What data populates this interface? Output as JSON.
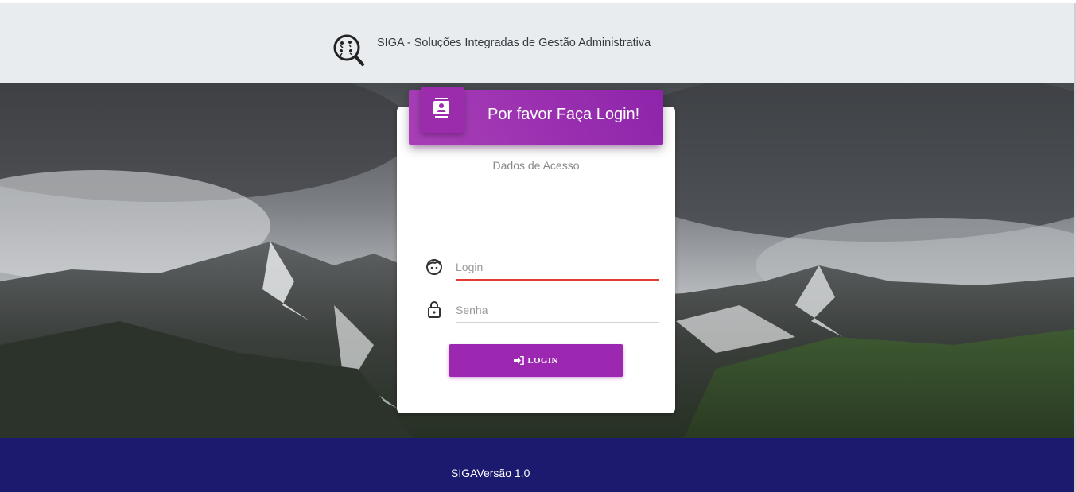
{
  "header": {
    "brand": "SIGA - Soluções Integradas de Gestão Administrativa",
    "logo_icon": "magnifier-logo-icon"
  },
  "login_card": {
    "title": "Por favor Faça Login!",
    "subtitle": "Dados de Acesso",
    "header_icon": "contact-book-icon",
    "login_field": {
      "placeholder": "Login",
      "value": "",
      "icon": "face-icon"
    },
    "password_field": {
      "placeholder": "Senha",
      "value": "",
      "icon": "lock-icon"
    },
    "login_button": {
      "label": "LOGIN",
      "icon": "sign-in-icon"
    }
  },
  "footer": {
    "text": "SIGAVersão 1.0"
  },
  "colors": {
    "accent": "#9c27b0",
    "header_bg": "#e9ecef",
    "footer_bg": "#1c1a6e",
    "error_underline": "#e53935"
  }
}
